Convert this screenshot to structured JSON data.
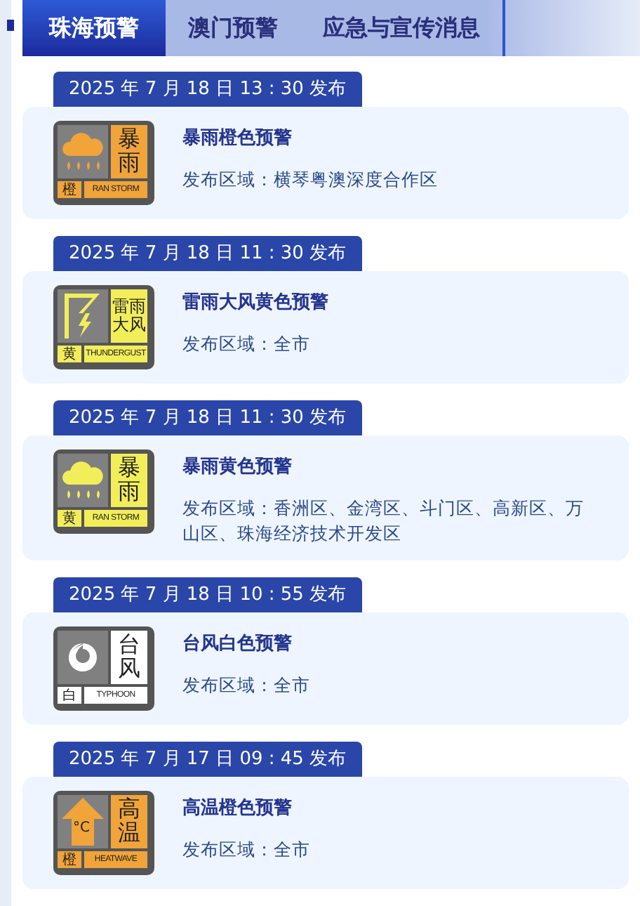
{
  "tabs": [
    {
      "label": "珠海预警",
      "selected": true
    },
    {
      "label": "澳门预警",
      "selected": false
    },
    {
      "label": "应急与宣传消息",
      "selected": false
    }
  ],
  "warnings": [
    {
      "date": "2025 年 7 月 18 日 13 : 30 发布",
      "icon": {
        "kind": "rainstorm",
        "color": "#f0a43a",
        "name": "暴雨",
        "level": "橙",
        "english": "RAN STORM"
      },
      "title": "暴雨橙色预警",
      "area": "发布区域：横琴粤澳深度合作区"
    },
    {
      "date": "2025 年 7 月 18 日 11 : 30 发布",
      "icon": {
        "kind": "thunder",
        "color": "#f2ee5a",
        "name": "雷雨大风",
        "level": "黄",
        "english": "THUNDERGUST"
      },
      "title": "雷雨大风黄色预警",
      "area": "发布区域：全市"
    },
    {
      "date": "2025 年 7 月 18 日 11 : 30 发布",
      "icon": {
        "kind": "rainstorm",
        "color": "#f2ee5a",
        "name": "暴雨",
        "level": "黄",
        "english": "RAN STORM"
      },
      "title": "暴雨黄色预警",
      "area": "发布区域：香洲区、金湾区、斗门区、高新区、万山区、珠海经济技术开发区"
    },
    {
      "date": "2025 年 7 月 18 日 10 : 55 发布",
      "icon": {
        "kind": "typhoon",
        "color": "#ffffff",
        "name": "台风",
        "level": "白",
        "english": "TYPHOON"
      },
      "title": "台风白色预警",
      "area": "发布区域：全市"
    },
    {
      "date": "2025 年 7 月 17 日 09 : 45 发布",
      "icon": {
        "kind": "heat",
        "color": "#f0a43a",
        "name": "高温",
        "level": "橙",
        "english": "HEATWAVE",
        "symbol": "°C"
      },
      "title": "高温橙色预警",
      "area": "发布区域：全市"
    }
  ]
}
